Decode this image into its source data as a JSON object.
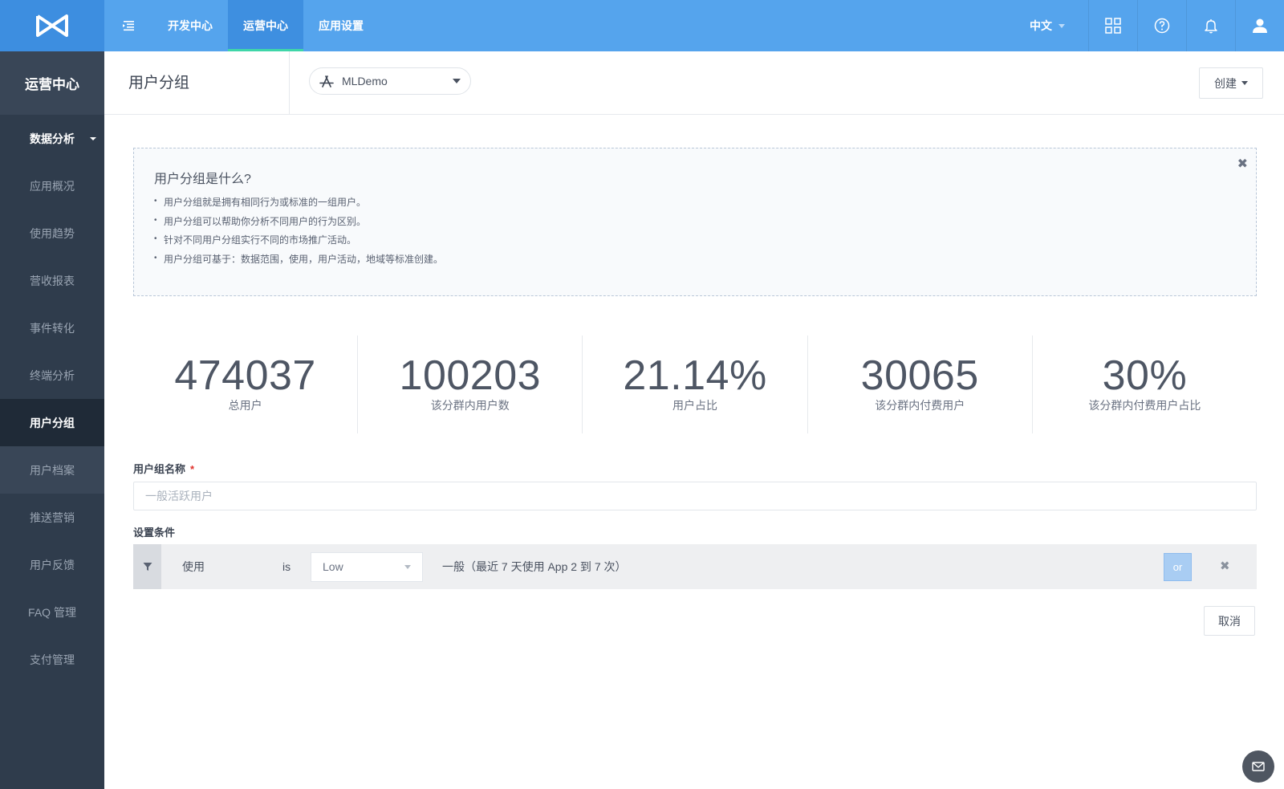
{
  "topbar": {
    "logo_icon": "brand-logo-icon",
    "menu_icon": "menu-collapse-icon",
    "nav": [
      {
        "label": "开发中心",
        "active": false
      },
      {
        "label": "运营中心",
        "active": true
      },
      {
        "label": "应用设置",
        "active": false
      }
    ],
    "language": "中文",
    "icons": [
      "apps-grid-icon",
      "help-icon",
      "bell-icon",
      "user-icon"
    ],
    "colors": {
      "bar": "#55a4ed",
      "active": "#3e8fe0",
      "underline": "#3fd6a8"
    }
  },
  "sidebar": {
    "header": "运营中心",
    "section": "数据分析",
    "items": [
      {
        "label": "应用概况"
      },
      {
        "label": "使用趋势"
      },
      {
        "label": "营收报表"
      },
      {
        "label": "事件转化"
      },
      {
        "label": "终端分析"
      },
      {
        "label": "用户分组",
        "active": true
      },
      {
        "label": "用户档案"
      },
      {
        "label": "推送营销"
      },
      {
        "label": "用户反馈"
      },
      {
        "label": "FAQ 管理"
      },
      {
        "label": "支付管理"
      }
    ]
  },
  "subheader": {
    "title": "用户分组",
    "app_select": {
      "value": "MLDemo",
      "icon": "app-store-icon"
    },
    "create_label": "创建"
  },
  "info": {
    "title": "用户分组是什么?",
    "items": [
      "用户分组就是拥有相同行为或标准的一组用户。",
      "用户分组可以帮助你分析不同用户的行为区别。",
      "针对不同用户分组实行不同的市场推广活动。",
      "用户分组可基于：数据范围，使用，用户活动，地域等标准创建。"
    ]
  },
  "stats": [
    {
      "value": "474037",
      "label": "总用户"
    },
    {
      "value": "100203",
      "label": "该分群内用户数"
    },
    {
      "value": "21.14%",
      "label": "用户占比"
    },
    {
      "value": "30065",
      "label": "该分群内付费用户"
    },
    {
      "value": "30%",
      "label": "该分群内付费用户占比"
    }
  ],
  "form": {
    "name_label": "用户组名称",
    "required_mark": "*",
    "name_placeholder": "一般活跃用户",
    "name_value": "",
    "conditions_label": "设置条件",
    "condition": {
      "field": "使用",
      "operator": "is",
      "value": "Low",
      "description": "一般（最近 7 天使用 App 2 到 7 次）",
      "or_label": "or",
      "remove_icon": "close-icon"
    },
    "cancel_label": "取消"
  },
  "fab_icon": "message-icon"
}
